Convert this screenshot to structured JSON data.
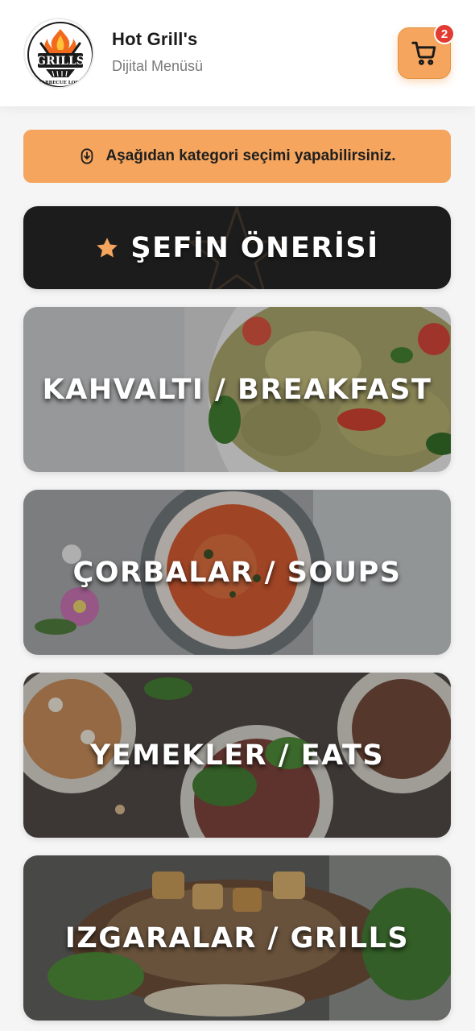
{
  "header": {
    "logo_text": "GRILLS",
    "logo_subtext": "BARBECUE LOGO",
    "title": "Hot Grill's",
    "subtitle": "Dijital Menüsü",
    "cart_icon": "shopping-cart-icon",
    "cart_count": "2"
  },
  "banner": {
    "icon": "arrow-down-circle-icon",
    "text": "Aşağıdan kategori seçimi yapabilirsiniz."
  },
  "chef": {
    "icon": "star-icon",
    "label": "ŞEFİN ÖNERİSİ",
    "accent": "#f5a55d"
  },
  "categories": [
    {
      "label": "KAHVALTI / BREAKFAST"
    },
    {
      "label": "ÇORBALAR / SOUPS"
    },
    {
      "label": "YEMEKLER / EATS"
    },
    {
      "label": "IZGARALAR / GRILLS"
    }
  ],
  "colors": {
    "accent": "#f5a55d",
    "badge": "#e23b31",
    "dark_card": "#1c1c1c"
  }
}
